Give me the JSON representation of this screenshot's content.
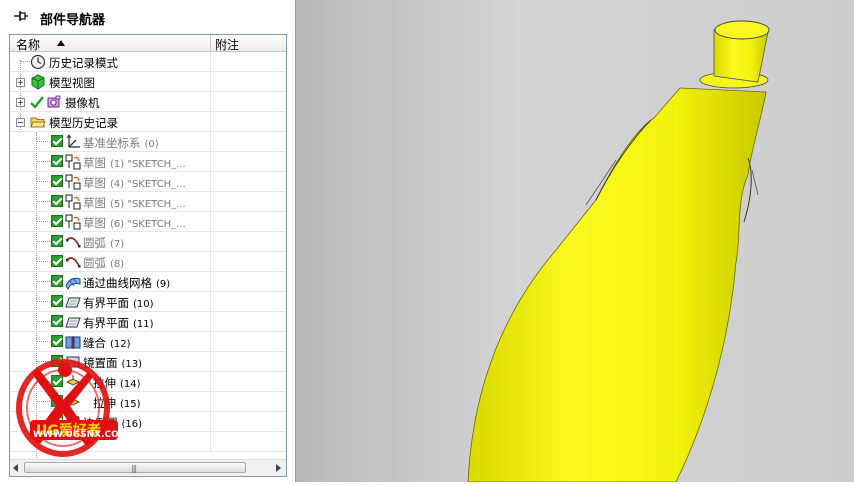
{
  "navigator": {
    "title": "部件导航器",
    "columns": {
      "name": "名称",
      "note": "附注"
    },
    "rows": [
      {
        "label": "历史记录模式",
        "num": "",
        "icon": "clock-icon",
        "gray": false
      },
      {
        "label": "模型视图",
        "num": "",
        "icon": "model-view-icon",
        "gray": false
      },
      {
        "label": "摄像机",
        "num": "",
        "icon": "camera-icon",
        "gray": false
      },
      {
        "label": "模型历史记录",
        "num": "",
        "icon": "folder-open-icon",
        "gray": false
      },
      {
        "label": "基准坐标系",
        "num": "(0)",
        "icon": "datum-csys-icon",
        "gray": true
      },
      {
        "label": "草图",
        "num": "(1) \"SKETCH_...",
        "icon": "sketch-icon",
        "gray": true
      },
      {
        "label": "草图",
        "num": "(4) \"SKETCH_...",
        "icon": "sketch-icon",
        "gray": true
      },
      {
        "label": "草图",
        "num": "(5) \"SKETCH_...",
        "icon": "sketch-icon",
        "gray": true
      },
      {
        "label": "草图",
        "num": "(6) \"SKETCH_...",
        "icon": "sketch-icon",
        "gray": true
      },
      {
        "label": "圆弧",
        "num": "(7)",
        "icon": "arc-icon",
        "gray": true
      },
      {
        "label": "圆弧",
        "num": "(8)",
        "icon": "arc-icon",
        "gray": true
      },
      {
        "label": "通过曲线网格",
        "num": "(9)",
        "icon": "curve-mesh-icon",
        "gray": false
      },
      {
        "label": "有界平面",
        "num": "(10)",
        "icon": "bounded-plane-icon",
        "gray": false
      },
      {
        "label": "有界平面",
        "num": "(11)",
        "icon": "bounded-plane-icon",
        "gray": false
      },
      {
        "label": "缝合",
        "num": "(12)",
        "icon": "sew-icon",
        "gray": false
      },
      {
        "label": "镜置面",
        "num": "(13)",
        "icon": "face-icon",
        "gray": false
      },
      {
        "label": "拉伸",
        "num": "(14)",
        "icon": "extrude-icon",
        "gray": false
      },
      {
        "label": "拉伸",
        "num": "(15)",
        "icon": "extrude-icon",
        "gray": false
      },
      {
        "label": "边倒圆",
        "num": "(16)",
        "icon": "edge-blend-icon",
        "gray": false
      }
    ]
  },
  "watermark": {
    "logo_text": "UG爱好者",
    "url": "WWW.UGSNX.COM"
  },
  "colors": {
    "model_yellow": "#f2f20a",
    "check_green": "#2f9b2f",
    "watermark_red": "#e01010",
    "viewport_gray": "#cdcdcd"
  }
}
